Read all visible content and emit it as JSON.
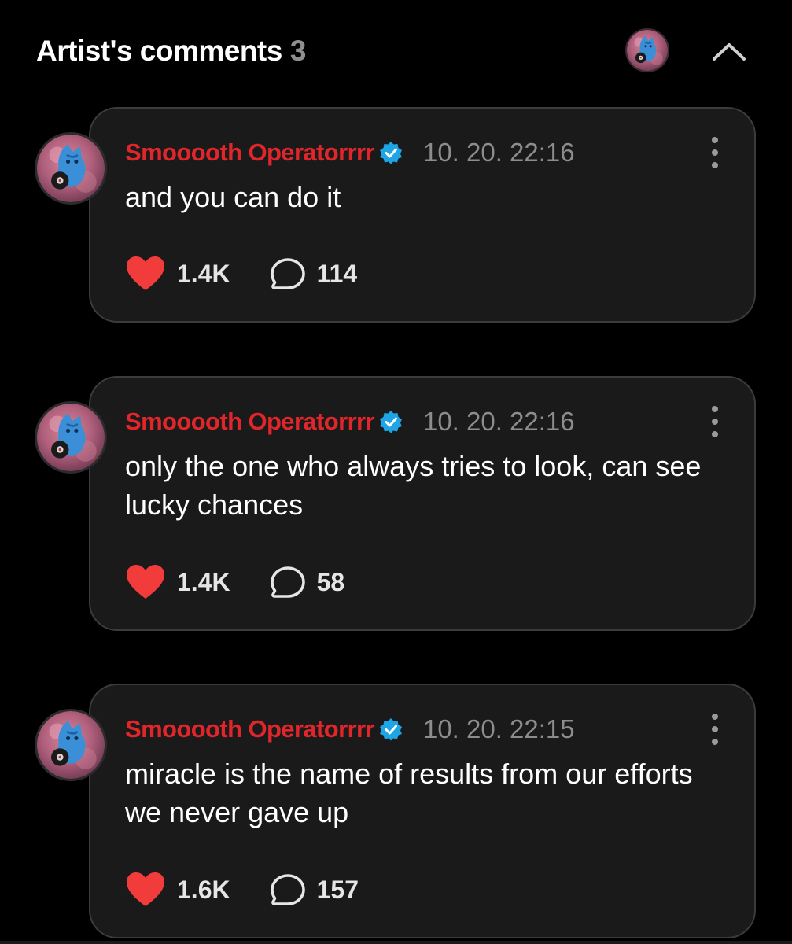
{
  "header": {
    "title": "Artist's comments",
    "count": "3"
  },
  "icons": {
    "collapse": "chevron-up-icon",
    "verified": "verified-badge-icon",
    "like": "heart-icon",
    "reply": "speech-bubble-icon",
    "more": "kebab-menu-icon"
  },
  "colors": {
    "author": "#e0262b",
    "heart": "#f23b3b",
    "verified": "#1ea5e6",
    "card_bg": "#1a1a1a",
    "card_border": "#3b3b3b",
    "timestamp": "#8d8d8d"
  },
  "comments": [
    {
      "author": "Smooooth Operatorrrr",
      "timestamp": "10. 20. 22:16",
      "text": "and you can do it",
      "likes": "1.4K",
      "replies": "114"
    },
    {
      "author": "Smooooth Operatorrrr",
      "timestamp": "10. 20. 22:16",
      "text": "only the one who always tries to look, can see lucky chances",
      "likes": "1.4K",
      "replies": "58"
    },
    {
      "author": "Smooooth Operatorrrr",
      "timestamp": "10. 20. 22:15",
      "text": "miracle is the name of results from our efforts we never gave up",
      "likes": "1.6K",
      "replies": "157"
    }
  ]
}
